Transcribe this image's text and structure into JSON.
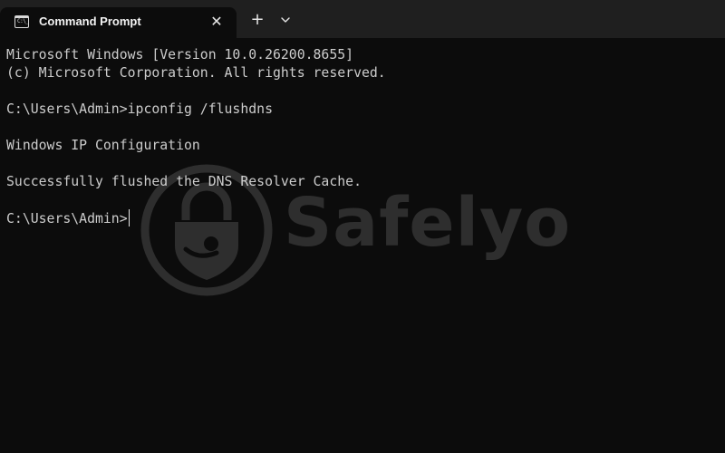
{
  "window": {
    "tab_title": "Command Prompt",
    "tab_icon": "cmd-icon",
    "tab_icon_glyph": "C:\\_",
    "close_glyph": "✕",
    "new_tab_glyph": "+",
    "dropdown_icon": "chevron-down-icon"
  },
  "terminal": {
    "lines": [
      "Microsoft Windows [Version 10.0.26200.8655]",
      "(c) Microsoft Corporation. All rights reserved.",
      "C:\\Users\\Admin>ipconfig /flushdns",
      "Windows IP Configuration",
      "Successfully flushed the DNS Resolver Cache.",
      "C:\\Users\\Admin>"
    ]
  },
  "watermark": {
    "text": "Safelyo",
    "icon": "shield-lock-icon"
  },
  "colors": {
    "background": "#0c0c0c",
    "tabbar": "#1f1f1f",
    "text": "#cccccc"
  }
}
